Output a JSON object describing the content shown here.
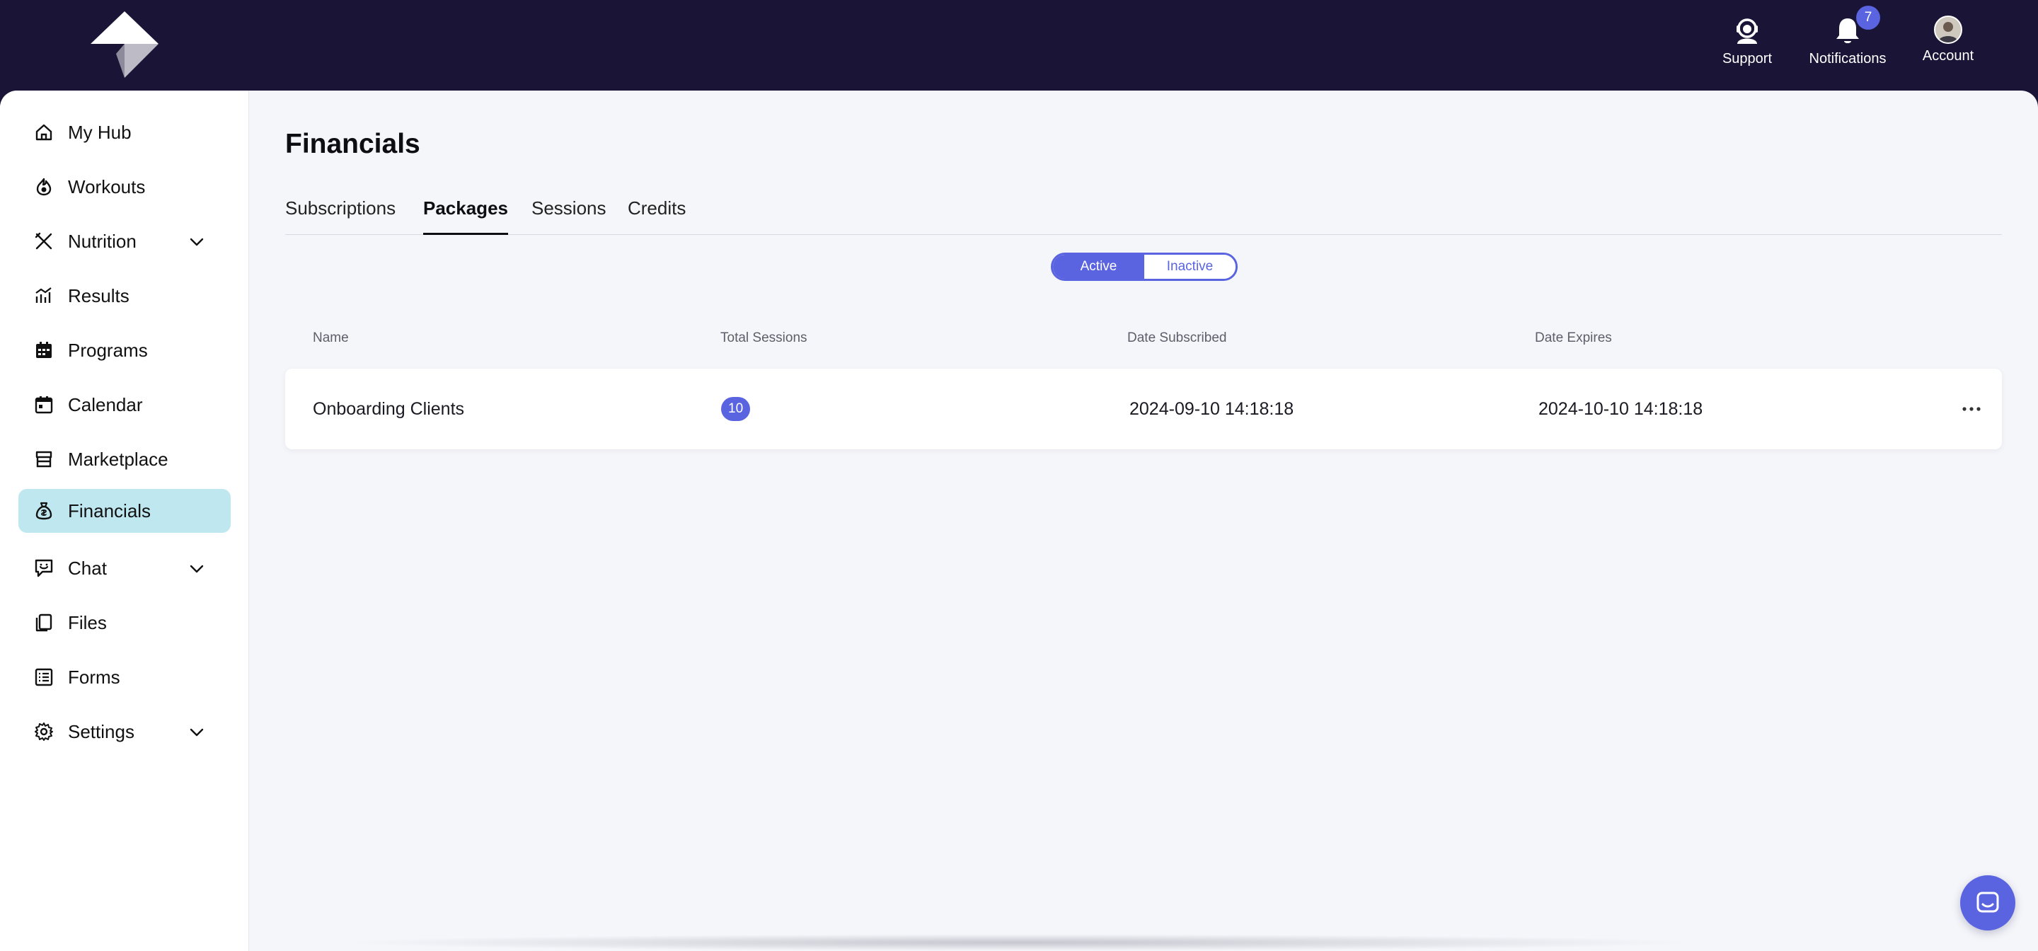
{
  "topbar": {
    "actions": [
      {
        "label": "Support",
        "icon": "headset-icon"
      },
      {
        "label": "Notifications",
        "icon": "bell-icon",
        "badge": "7"
      },
      {
        "label": "Account",
        "icon": "avatar"
      }
    ]
  },
  "sidebar": {
    "items": [
      {
        "label": "My Hub",
        "icon": "home-icon",
        "expandable": false,
        "active": false
      },
      {
        "label": "Workouts",
        "icon": "flame-icon",
        "expandable": false,
        "active": false
      },
      {
        "label": "Nutrition",
        "icon": "fork-knife-icon",
        "expandable": true,
        "active": false
      },
      {
        "label": "Results",
        "icon": "chart-icon",
        "expandable": false,
        "active": false
      },
      {
        "label": "Programs",
        "icon": "calendar-grid-icon",
        "expandable": false,
        "active": false
      },
      {
        "label": "Calendar",
        "icon": "calendar-icon",
        "expandable": false,
        "active": false
      },
      {
        "label": "Marketplace",
        "icon": "storefront-icon",
        "expandable": false,
        "active": false
      },
      {
        "label": "Financials",
        "icon": "money-bag-icon",
        "expandable": false,
        "active": true
      },
      {
        "label": "Chat",
        "icon": "chat-icon",
        "expandable": true,
        "active": false
      },
      {
        "label": "Files",
        "icon": "files-icon",
        "expandable": false,
        "active": false
      },
      {
        "label": "Forms",
        "icon": "form-icon",
        "expandable": false,
        "active": false
      },
      {
        "label": "Settings",
        "icon": "gear-icon",
        "expandable": true,
        "active": false
      }
    ]
  },
  "main": {
    "title": "Financials",
    "tabs": [
      {
        "label": "Subscriptions",
        "active": false
      },
      {
        "label": "Packages",
        "active": true
      },
      {
        "label": "Sessions",
        "active": false
      },
      {
        "label": "Credits",
        "active": false
      }
    ],
    "status_toggle": {
      "options": [
        "Active",
        "Inactive"
      ],
      "selected": "Active"
    },
    "table": {
      "columns": [
        "Name",
        "Total Sessions",
        "Date Subscribed",
        "Date Expires"
      ],
      "rows": [
        {
          "name": "Onboarding Clients",
          "total_sessions": "10",
          "date_subscribed": "2024-09-10 14:18:18",
          "date_expires": "2024-10-10 14:18:18"
        }
      ]
    }
  },
  "colors": {
    "topbar_bg": "#1a1536",
    "accent": "#5a63e0",
    "active_nav_bg": "#bfe7ef",
    "page_bg": "#f5f6fa"
  }
}
